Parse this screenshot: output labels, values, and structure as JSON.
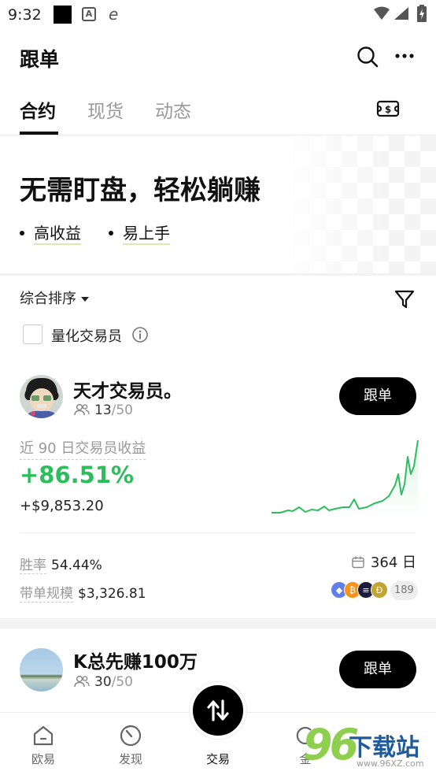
{
  "status_bar": {
    "time": "9:32"
  },
  "header": {
    "title": "跟单"
  },
  "tabs": [
    {
      "label": "合约",
      "active": true
    },
    {
      "label": "现货",
      "active": false
    },
    {
      "label": "动态",
      "active": false
    }
  ],
  "banner": {
    "title": "无需盯盘，轻松躺赚",
    "bullets": [
      "高收益",
      "易上手"
    ]
  },
  "filters": {
    "sort_label": "综合排序",
    "quant_label": "量化交易员",
    "quant_checked": false
  },
  "traders": [
    {
      "name": "天才交易员。",
      "followers": "13",
      "followers_cap": "/50",
      "follow_label": "跟单",
      "pnl_label": "近 90 日交易员收益",
      "pnl_pct": "+86.51%",
      "pnl_amount": "+$9,853.20",
      "win_rate_label": "胜率",
      "win_rate": "54.44%",
      "days": "364 日",
      "aum_label": "带单规模",
      "aum": "$3,326.81",
      "coins_more": "189"
    },
    {
      "name": "K总先赚100万",
      "followers": "30",
      "followers_cap": "/50",
      "follow_label": "跟单"
    }
  ],
  "nav": [
    {
      "label": "欧易",
      "icon": "home-icon",
      "active": false
    },
    {
      "label": "发现",
      "icon": "discover-icon",
      "active": false
    },
    {
      "label": "交易",
      "icon": "trade-icon",
      "active": true
    },
    {
      "label": "金",
      "icon": "finance-icon",
      "active": false
    }
  ],
  "watermark": {
    "digits": "96",
    "text": "下载站",
    "url": "www.96XZ.com"
  },
  "colors": {
    "accent_green": "#2dbd5d",
    "button_black": "#000000"
  }
}
